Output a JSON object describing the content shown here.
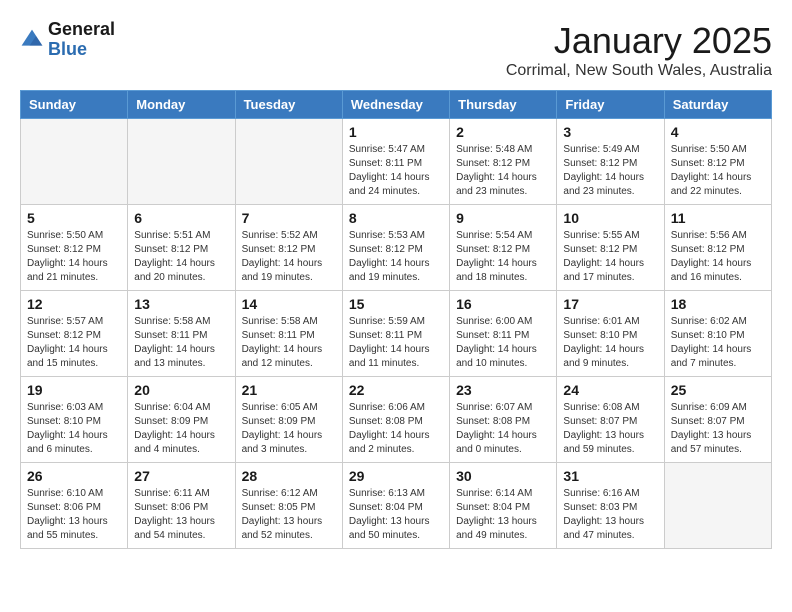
{
  "logo": {
    "line1": "General",
    "line2": "Blue"
  },
  "title": "January 2025",
  "location": "Corrimal, New South Wales, Australia",
  "weekdays": [
    "Sunday",
    "Monday",
    "Tuesday",
    "Wednesday",
    "Thursday",
    "Friday",
    "Saturday"
  ],
  "weeks": [
    [
      {
        "day": "",
        "info": ""
      },
      {
        "day": "",
        "info": ""
      },
      {
        "day": "",
        "info": ""
      },
      {
        "day": "1",
        "info": "Sunrise: 5:47 AM\nSunset: 8:11 PM\nDaylight: 14 hours\nand 24 minutes."
      },
      {
        "day": "2",
        "info": "Sunrise: 5:48 AM\nSunset: 8:12 PM\nDaylight: 14 hours\nand 23 minutes."
      },
      {
        "day": "3",
        "info": "Sunrise: 5:49 AM\nSunset: 8:12 PM\nDaylight: 14 hours\nand 23 minutes."
      },
      {
        "day": "4",
        "info": "Sunrise: 5:50 AM\nSunset: 8:12 PM\nDaylight: 14 hours\nand 22 minutes."
      }
    ],
    [
      {
        "day": "5",
        "info": "Sunrise: 5:50 AM\nSunset: 8:12 PM\nDaylight: 14 hours\nand 21 minutes."
      },
      {
        "day": "6",
        "info": "Sunrise: 5:51 AM\nSunset: 8:12 PM\nDaylight: 14 hours\nand 20 minutes."
      },
      {
        "day": "7",
        "info": "Sunrise: 5:52 AM\nSunset: 8:12 PM\nDaylight: 14 hours\nand 19 minutes."
      },
      {
        "day": "8",
        "info": "Sunrise: 5:53 AM\nSunset: 8:12 PM\nDaylight: 14 hours\nand 19 minutes."
      },
      {
        "day": "9",
        "info": "Sunrise: 5:54 AM\nSunset: 8:12 PM\nDaylight: 14 hours\nand 18 minutes."
      },
      {
        "day": "10",
        "info": "Sunrise: 5:55 AM\nSunset: 8:12 PM\nDaylight: 14 hours\nand 17 minutes."
      },
      {
        "day": "11",
        "info": "Sunrise: 5:56 AM\nSunset: 8:12 PM\nDaylight: 14 hours\nand 16 minutes."
      }
    ],
    [
      {
        "day": "12",
        "info": "Sunrise: 5:57 AM\nSunset: 8:12 PM\nDaylight: 14 hours\nand 15 minutes."
      },
      {
        "day": "13",
        "info": "Sunrise: 5:58 AM\nSunset: 8:11 PM\nDaylight: 14 hours\nand 13 minutes."
      },
      {
        "day": "14",
        "info": "Sunrise: 5:58 AM\nSunset: 8:11 PM\nDaylight: 14 hours\nand 12 minutes."
      },
      {
        "day": "15",
        "info": "Sunrise: 5:59 AM\nSunset: 8:11 PM\nDaylight: 14 hours\nand 11 minutes."
      },
      {
        "day": "16",
        "info": "Sunrise: 6:00 AM\nSunset: 8:11 PM\nDaylight: 14 hours\nand 10 minutes."
      },
      {
        "day": "17",
        "info": "Sunrise: 6:01 AM\nSunset: 8:10 PM\nDaylight: 14 hours\nand 9 minutes."
      },
      {
        "day": "18",
        "info": "Sunrise: 6:02 AM\nSunset: 8:10 PM\nDaylight: 14 hours\nand 7 minutes."
      }
    ],
    [
      {
        "day": "19",
        "info": "Sunrise: 6:03 AM\nSunset: 8:10 PM\nDaylight: 14 hours\nand 6 minutes."
      },
      {
        "day": "20",
        "info": "Sunrise: 6:04 AM\nSunset: 8:09 PM\nDaylight: 14 hours\nand 4 minutes."
      },
      {
        "day": "21",
        "info": "Sunrise: 6:05 AM\nSunset: 8:09 PM\nDaylight: 14 hours\nand 3 minutes."
      },
      {
        "day": "22",
        "info": "Sunrise: 6:06 AM\nSunset: 8:08 PM\nDaylight: 14 hours\nand 2 minutes."
      },
      {
        "day": "23",
        "info": "Sunrise: 6:07 AM\nSunset: 8:08 PM\nDaylight: 14 hours\nand 0 minutes."
      },
      {
        "day": "24",
        "info": "Sunrise: 6:08 AM\nSunset: 8:07 PM\nDaylight: 13 hours\nand 59 minutes."
      },
      {
        "day": "25",
        "info": "Sunrise: 6:09 AM\nSunset: 8:07 PM\nDaylight: 13 hours\nand 57 minutes."
      }
    ],
    [
      {
        "day": "26",
        "info": "Sunrise: 6:10 AM\nSunset: 8:06 PM\nDaylight: 13 hours\nand 55 minutes."
      },
      {
        "day": "27",
        "info": "Sunrise: 6:11 AM\nSunset: 8:06 PM\nDaylight: 13 hours\nand 54 minutes."
      },
      {
        "day": "28",
        "info": "Sunrise: 6:12 AM\nSunset: 8:05 PM\nDaylight: 13 hours\nand 52 minutes."
      },
      {
        "day": "29",
        "info": "Sunrise: 6:13 AM\nSunset: 8:04 PM\nDaylight: 13 hours\nand 50 minutes."
      },
      {
        "day": "30",
        "info": "Sunrise: 6:14 AM\nSunset: 8:04 PM\nDaylight: 13 hours\nand 49 minutes."
      },
      {
        "day": "31",
        "info": "Sunrise: 6:16 AM\nSunset: 8:03 PM\nDaylight: 13 hours\nand 47 minutes."
      },
      {
        "day": "",
        "info": ""
      }
    ]
  ]
}
